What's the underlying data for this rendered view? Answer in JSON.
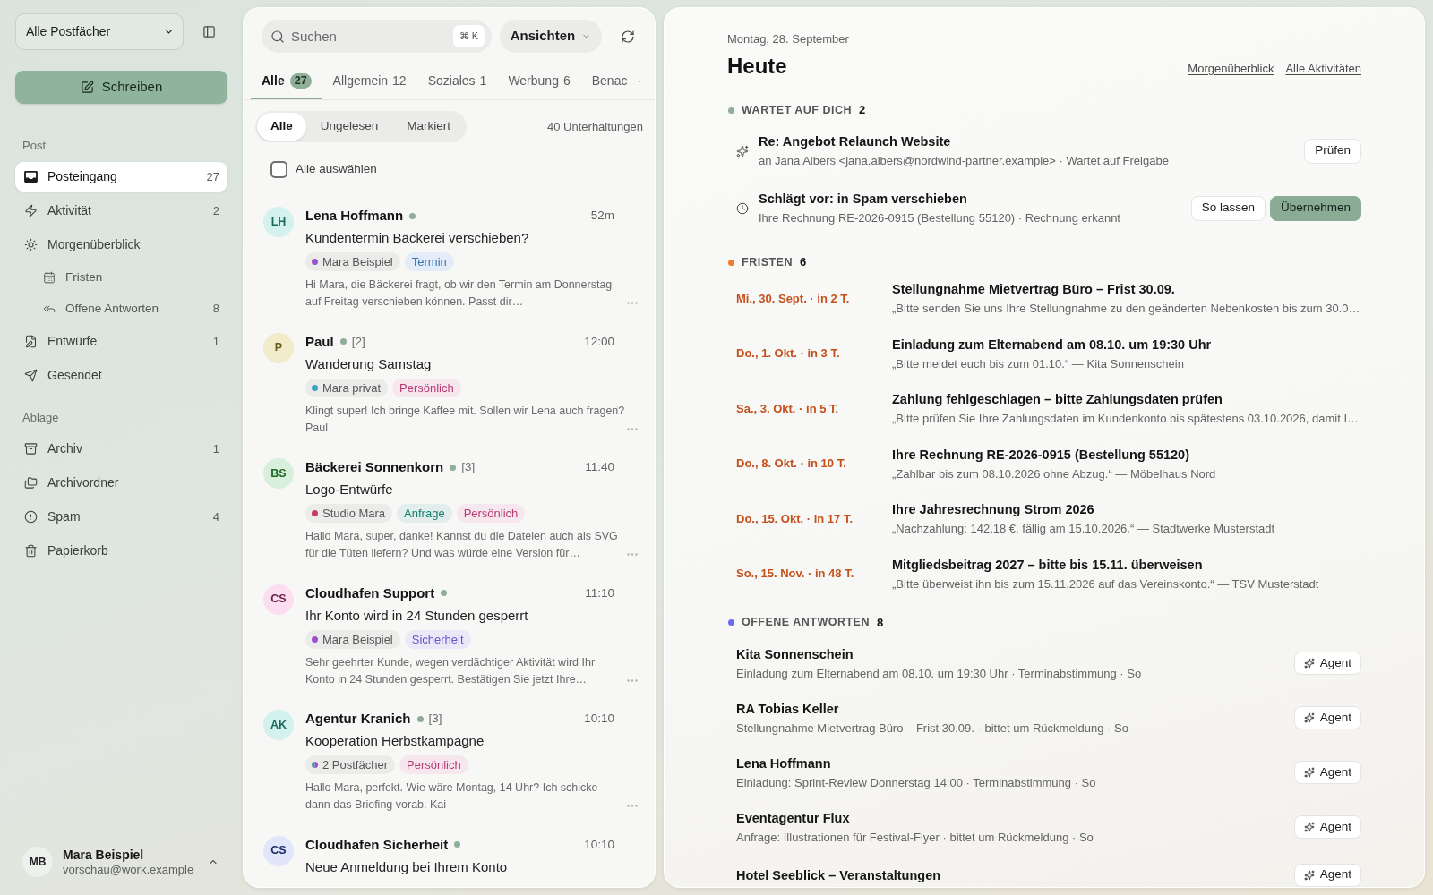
{
  "sidebar": {
    "mailbox_select": "Alle Postfächer",
    "compose_button": "Schreiben",
    "sections": [
      {
        "title": "Post",
        "items": [
          {
            "label": "Posteingang",
            "count": "27",
            "selected": true
          },
          {
            "label": "Aktivität",
            "count": "2",
            "selected": false
          },
          {
            "label": "Morgenüberblick",
            "selected": false,
            "children": [
              {
                "label": "Fristen",
                "selected": false
              },
              {
                "label": "Offene Antworten",
                "count": "8",
                "selected": false
              }
            ]
          },
          {
            "label": "Entwürfe",
            "count": "1",
            "selected": false
          },
          {
            "label": "Gesendet",
            "selected": false
          }
        ]
      },
      {
        "title": "Ablage",
        "items": [
          {
            "label": "Archiv",
            "count": "1",
            "selected": false
          },
          {
            "label": "Archivordner",
            "selected": false
          },
          {
            "label": "Spam",
            "count": "4",
            "selected": false
          },
          {
            "label": "Papierkorb",
            "selected": false
          }
        ]
      }
    ],
    "user": {
      "initials": "MB",
      "name": "Mara Beispiel",
      "email": "vorschau@work.example"
    }
  },
  "list": {
    "search": {
      "placeholder": "Suchen",
      "shortcut": "⌘ K"
    },
    "views_button": "Ansichten",
    "tabs": [
      {
        "label": "Alle",
        "count": "27",
        "selected": true
      },
      {
        "label": "Allgemein",
        "count": "12",
        "selected": false
      },
      {
        "label": "Soziales",
        "count": "1",
        "selected": false
      },
      {
        "label": "Werbung",
        "count": "6",
        "selected": false
      },
      {
        "label": "Benac",
        "selected": false
      }
    ],
    "filters": [
      {
        "label": "Alle",
        "selected": true
      },
      {
        "label": "Ungelesen",
        "selected": false
      },
      {
        "label": "Markiert",
        "selected": false
      }
    ],
    "conversation_count": "40 Unterhaltungen",
    "select_all": {
      "label": "Alle auswählen",
      "checked": false
    },
    "messages": [
      {
        "initials": "LH",
        "color": "#d3f1ed",
        "sender": "Lena Hoffmann",
        "unread": true,
        "time": "52m",
        "subject": "Kundentermin Bäckerei verschieben?",
        "account": {
          "label": "Mara Beispiel",
          "dots": [
            {
              "color": "#9a4fd0"
            }
          ]
        },
        "labels": [
          {
            "label": "Termin",
            "color": "#2f74c0"
          }
        ],
        "preview": "Hi Mara, die Bäckerei fragt, ob wir den Termin am Donnerstag auf Freitag verschieben können. Passt dir…"
      },
      {
        "initials": "P",
        "color": "#f1ebc9",
        "sender": "Paul",
        "unread": true,
        "thread_count": "[2]",
        "time": "12:00",
        "subject": "Wanderung Samstag",
        "account": {
          "label": "Mara privat",
          "dots": [
            {
              "color": "#3aa3c4"
            }
          ]
        },
        "labels": [
          {
            "label": "Persönlich",
            "color": "#b83c75"
          }
        ],
        "preview": "Klingt super! Ich bringe Kaffee mit. Sollen wir Lena auch fragen? Paul"
      },
      {
        "initials": "BS",
        "color": "#d8efdb",
        "sender": "Bäckerei Sonnenkorn",
        "unread": true,
        "thread_count": "[3]",
        "time": "11:40",
        "subject": "Logo-Entwürfe",
        "account": {
          "label": "Studio Mara",
          "dots": [
            {
              "color": "#c73b5f"
            }
          ]
        },
        "labels": [
          {
            "label": "Anfrage",
            "color": "#17806f"
          },
          {
            "label": "Persönlich",
            "color": "#b83c75"
          }
        ],
        "preview": "Hallo Mara, super, danke! Kannst du die Dateien auch als SVG für die Tüten liefern? Und was würde eine Version für…"
      },
      {
        "initials": "CS",
        "color": "#fbdff0",
        "sender": "Cloudhafen Support",
        "unread": true,
        "time": "11:10",
        "subject": "Ihr Konto wird in 24 Stunden gesperrt",
        "account": {
          "label": "Mara Beispiel",
          "dots": [
            {
              "color": "#9a4fd0"
            }
          ]
        },
        "labels": [
          {
            "label": "Sicherheit",
            "color": "#6756c9"
          }
        ],
        "preview": "Sehr geehrter Kunde, wegen verdächtiger Aktivität wird Ihr Konto in 24 Stunden gesperrt. Bestätigen Sie jetzt Ihre…"
      },
      {
        "initials": "AK",
        "color": "#d3f1ed",
        "sender": "Agentur Kranich",
        "unread": true,
        "thread_count": "[3]",
        "time": "10:10",
        "subject": "Kooperation Herbstkampagne",
        "account": {
          "label": "2 Postfächer",
          "dots": [
            {
              "color": "#3aa89a"
            },
            {
              "color": "#9a4fd0"
            }
          ]
        },
        "labels": [
          {
            "label": "Persönlich",
            "color": "#b83c75"
          }
        ],
        "preview": "Hallo Mara, perfekt. Wie wäre Montag, 14 Uhr? Ich schicke dann das Briefing vorab. Kai"
      },
      {
        "initials": "CS",
        "color": "#e1e6fb",
        "sender": "Cloudhafen Sicherheit",
        "unread": true,
        "time": "10:10",
        "subject": "Neue Anmeldung bei Ihrem Konto"
      }
    ]
  },
  "today": {
    "date": "Montag, 28. September",
    "title": "Heute",
    "links": [
      "Morgenüberblick",
      "Alle Aktivitäten"
    ],
    "sections": [
      {
        "kind": "waiting",
        "title": "WARTET AUF DICH",
        "count": "2",
        "color": "#8fae98",
        "items": [
          {
            "kind": "draft",
            "title": "Re: Angebot Relaunch Website",
            "detail": "an Jana Albers <jana.albers@nordwind-partner.example> · Wartet auf Freigabe",
            "buttons": [
              {
                "label": "Prüfen",
                "primary": false
              }
            ]
          },
          {
            "kind": "suggestion",
            "title": "Schlägt vor: in Spam verschieben",
            "detail": "Ihre Rechnung RE-2026-0915 (Bestellung 55120) · Rechnung erkannt",
            "buttons": [
              {
                "label": "So lassen",
                "primary": false
              },
              {
                "label": "Übernehmen",
                "primary": true
              }
            ]
          }
        ]
      },
      {
        "kind": "deadlines",
        "title": "FRISTEN",
        "count": "6",
        "color": "#f07d2c",
        "items": [
          {
            "due": "Mi., 30. Sept. · in 2 T.",
            "title": "Stellungnahme Mietvertrag Büro – Frist 30.09.",
            "quote": "„Bitte senden Sie uns Ihre Stellungnahme zu den geänderten Nebenkosten bis zum 30.0…"
          },
          {
            "due": "Do., 1. Okt. · in 3 T.",
            "title": "Einladung zum Elternabend am 08.10. um 19:30 Uhr",
            "quote": "„Bitte meldet euch bis zum 01.10.“ — Kita Sonnenschein"
          },
          {
            "due": "Sa., 3. Okt. · in 5 T.",
            "title": "Zahlung fehlgeschlagen – bitte Zahlungsdaten prüfen",
            "quote": "„Bitte prüfen Sie Ihre Zahlungsdaten im Kundenkonto bis spätestens 03.10.2026, damit I…"
          },
          {
            "due": "Do., 8. Okt. · in 10 T.",
            "title": "Ihre Rechnung RE-2026-0915 (Bestellung 55120)",
            "quote": "„Zahlbar bis zum 08.10.2026 ohne Abzug.“ — Möbelhaus Nord"
          },
          {
            "due": "Do., 15. Okt. · in 17 T.",
            "title": "Ihre Jahresrechnung Strom 2026",
            "quote": "„Nachzahlung: 142,18 €, fällig am 15.10.2026.“ — Stadtwerke Musterstadt"
          },
          {
            "due": "So., 15. Nov. · in 48 T.",
            "title": "Mitgliedsbeitrag 2027 – bitte bis 15.11. überweisen",
            "quote": "„Bitte überweist ihn bis zum 15.11.2026 auf das Vereinskonto.“ — TSV Musterstadt"
          }
        ]
      },
      {
        "kind": "replies",
        "title": "OFFENE ANTWORTEN",
        "count": "8",
        "color": "#6b6cf0",
        "items": [
          {
            "name": "Kita Sonnenschein",
            "detail": "Einladung zum Elternabend am 08.10. um 19:30 Uhr · Terminabstimmung · So",
            "button": "Agent"
          },
          {
            "name": "RA Tobias Keller",
            "detail": "Stellungnahme Mietvertrag Büro – Frist 30.09. · bittet um Rückmeldung · So",
            "button": "Agent"
          },
          {
            "name": "Lena Hoffmann",
            "detail": "Einladung: Sprint-Review Donnerstag 14:00 · Terminabstimmung · So",
            "button": "Agent"
          },
          {
            "name": "Eventagentur Flux",
            "detail": "Anfrage: Illustrationen für Festival-Flyer · bittet um Rückmeldung · So",
            "button": "Agent"
          },
          {
            "name": "Hotel Seeblick – Veranstaltungen",
            "button": "Agent"
          }
        ]
      }
    ]
  }
}
